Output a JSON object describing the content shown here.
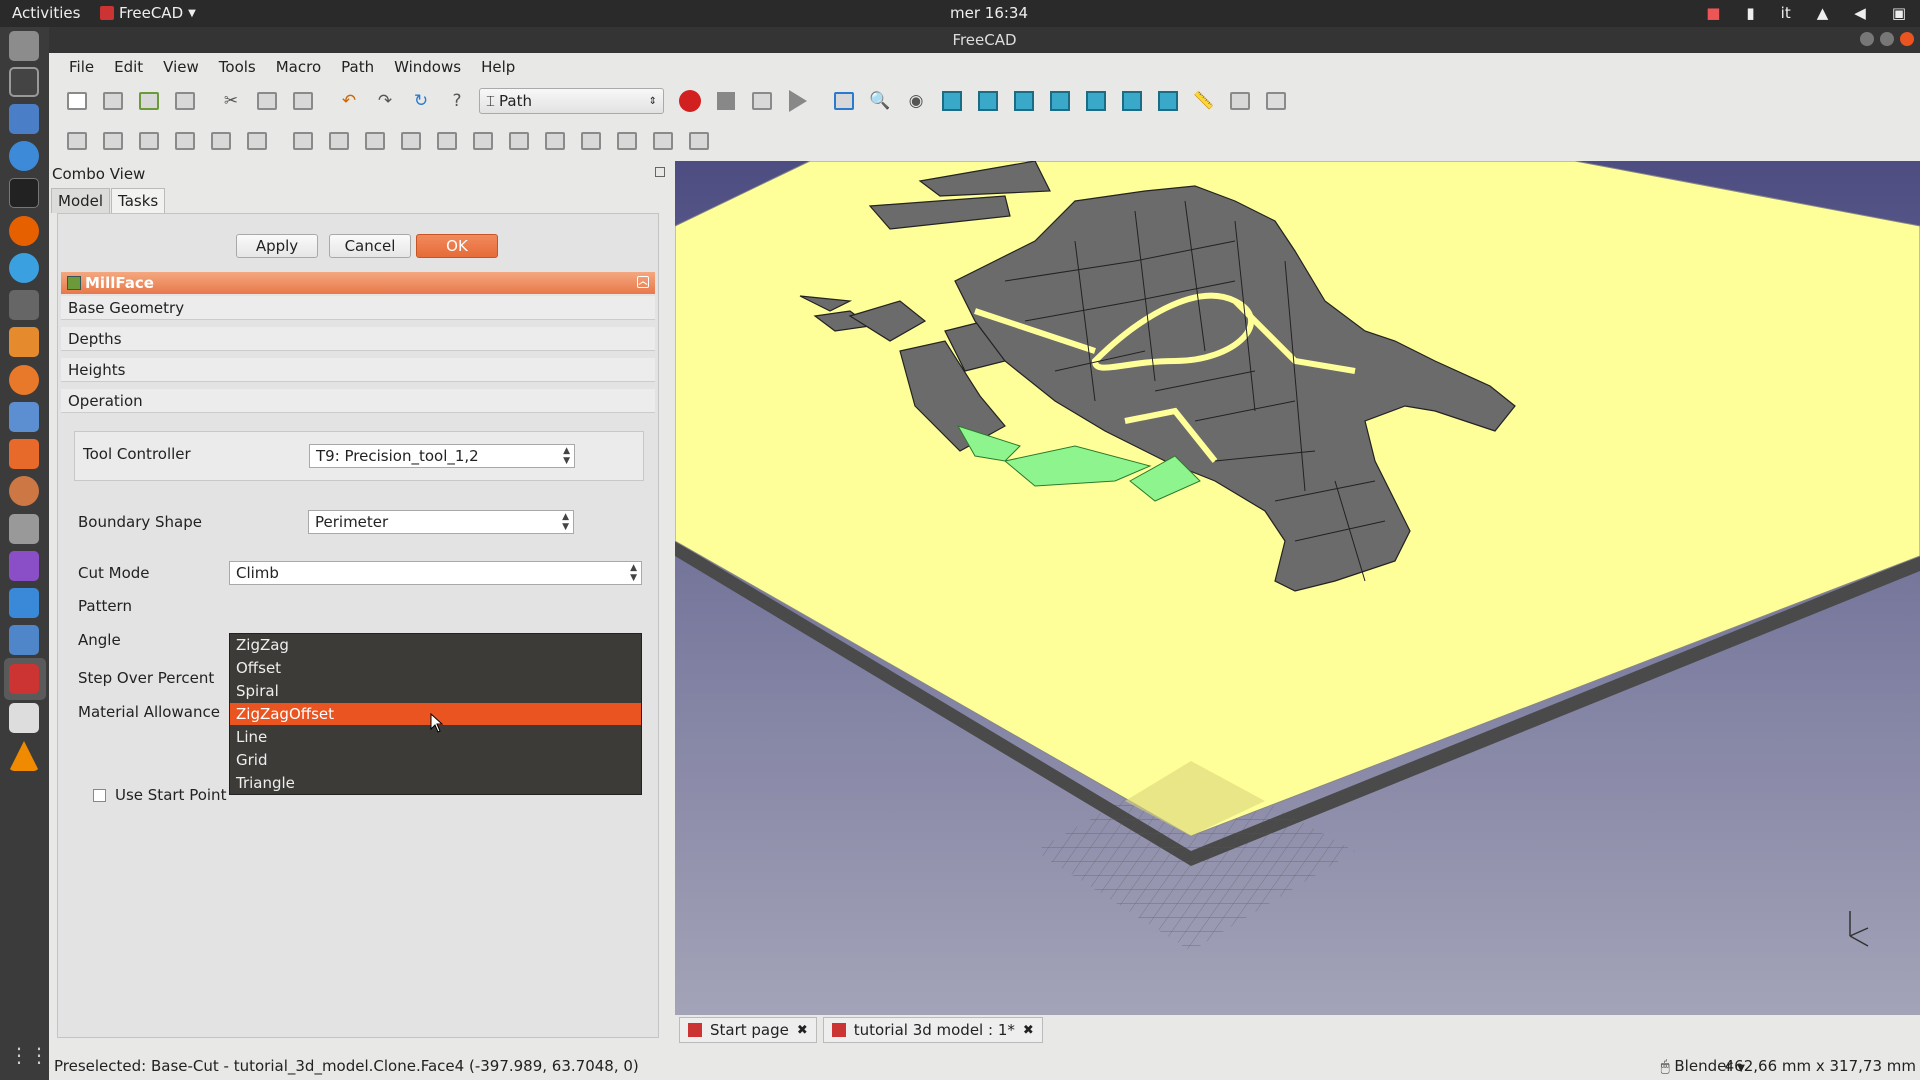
{
  "topbar": {
    "activities": "Activities",
    "app": "FreeCAD",
    "clock": "mer 16:34",
    "lang": "it"
  },
  "window": {
    "title": "FreeCAD"
  },
  "menu": [
    "File",
    "Edit",
    "View",
    "Tools",
    "Macro",
    "Path",
    "Windows",
    "Help"
  ],
  "toolbar": {
    "workbench": "Path"
  },
  "combo_view": {
    "title": "Combo View",
    "tabs": [
      "Model",
      "Tasks"
    ],
    "active_tab": "Tasks"
  },
  "task": {
    "apply": "Apply",
    "cancel": "Cancel",
    "ok": "OK",
    "panel_title": "MillFace",
    "sections": [
      "Base Geometry",
      "Depths",
      "Heights",
      "Operation"
    ],
    "tool_controller_label": "Tool Controller",
    "tool_controller_value": "T9: Precision_tool_1,2",
    "boundary_shape_label": "Boundary Shape",
    "boundary_shape_value": "Perimeter",
    "cut_mode_label": "Cut Mode",
    "cut_mode_value": "Climb",
    "pattern_label": "Pattern",
    "angle_label": "Angle",
    "step_over_label": "Step Over Percent",
    "material_allowance_label": "Material Allowance",
    "use_start_point_label": "Use Start Point",
    "use_start_point_checked": false
  },
  "pattern_dropdown": {
    "options": [
      "ZigZag",
      "Offset",
      "Spiral",
      "ZigZagOffset",
      "Line",
      "Grid",
      "Triangle"
    ],
    "highlighted": "ZigZagOffset"
  },
  "documents": [
    "Start page",
    "tutorial 3d model : 1*"
  ],
  "status": {
    "message": "Preselected: Base-Cut - tutorial_3d_model.Clone.Face4 (-397.989, 63.7048, 0)",
    "nav_style": "Blender",
    "dimensions": "462,66 mm x 317,73 mm"
  },
  "colors": {
    "accent": "#e95420",
    "stock": "#ffff99",
    "island": "#6b6b6b",
    "selected_face": "#8ef58e",
    "background_gradient_top": "#5a5a8a",
    "background_gradient_bottom": "#9e9eb5"
  }
}
